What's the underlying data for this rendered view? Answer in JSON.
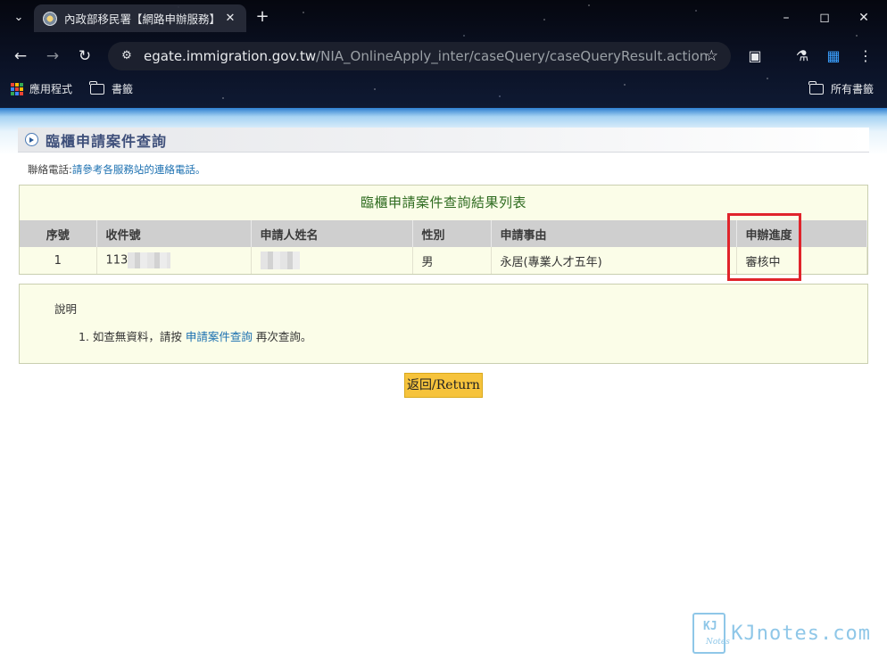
{
  "browser": {
    "tab_title": "內政部移民署【網路申辦服務】",
    "url_domain": "egate.immigration.gov.tw",
    "url_path": "/NIA_OnlineApply_inter/caseQuery/caseQueryResult.action",
    "bookmarks": {
      "apps": "應用程式",
      "bookmarks": "書籤",
      "all_bookmarks": "所有書籤"
    }
  },
  "page": {
    "section_title": "臨櫃申請案件查詢",
    "contact_prefix": "聯絡電話:",
    "contact_link": "請參考各服務站的連絡電話。",
    "result": {
      "caption": "臨櫃申請案件查詢結果列表",
      "headers": {
        "seq": "序號",
        "receipt_no": "收件號",
        "applicant_name": "申請人姓名",
        "gender": "性別",
        "reason": "申請事由",
        "progress": "申辦進度"
      },
      "rows": [
        {
          "seq": "1",
          "receipt_no": "113",
          "applicant_name": "",
          "gender": "男",
          "reason": "永居(專業人才五年)",
          "progress": "審核中"
        }
      ]
    },
    "note": {
      "title": "說明",
      "item_prefix": "1. 如查無資料，請按 ",
      "item_link": "申請案件查詢",
      "item_suffix": " 再次查詢。"
    },
    "return_label": "返回/Return"
  },
  "watermark": {
    "logo_text": "KJ",
    "logo_sub": "Notes",
    "text": "KJnotes.com"
  },
  "colors": {
    "highlight": "#e0242b",
    "link": "#1a6fb0",
    "caption_green": "#2e6b1f",
    "button": "#f6c33c"
  }
}
